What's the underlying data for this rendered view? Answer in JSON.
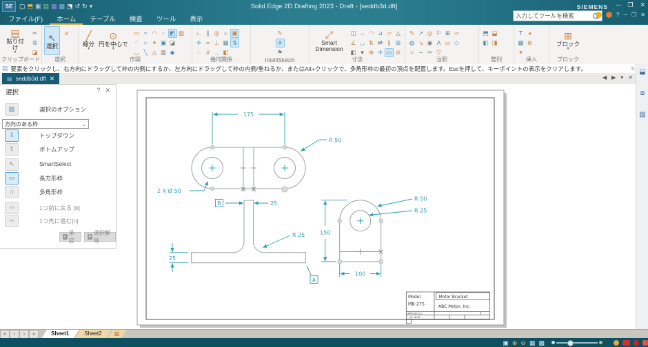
{
  "colors": {
    "titlebar": "#1e6b7e",
    "dimension_accent": "#2f9fb0",
    "ribbon_bg": "#f4f3f1",
    "statusbar": "#0c5061",
    "highlight": "#cfe7f7"
  },
  "window": {
    "app_icon": "SE",
    "title": "Solid Edge 2D Drafting 2023 - Draft - [seddb3d.dft]",
    "brand": "SIEMENS",
    "controls": {
      "minimize": "─",
      "maximize": "❐",
      "close": "✕"
    },
    "doc_controls": {
      "help": "?",
      "minimize": "─",
      "restore": "❐",
      "close": "✕"
    },
    "quick_access": [
      "▢|#e8eef2",
      "⬒|#e8b54d",
      "▣|#b9cdea",
      "▤|#8fc48f",
      "▦|#9b8fd8",
      "▩|#8fb3d8",
      "⬔|#e8eef2",
      "↺|#e8eef2",
      "↻|#e8eef2",
      "▾|#cfe0e8"
    ]
  },
  "search": {
    "placeholder": "入力してツールを検索"
  },
  "menu_tabs": [
    {
      "label": "ファイル(F)"
    },
    {
      "label": "ホーム",
      "active": true
    },
    {
      "label": "テーブル"
    },
    {
      "label": "検査"
    },
    {
      "label": "ツール"
    },
    {
      "label": "表示"
    }
  ],
  "ribbon": {
    "groups": [
      {
        "label": "クリップボード",
        "bigs": [
          {
            "label": "貼り付け",
            "glyph": "▤|#c77f3d",
            "arrow": true
          }
        ],
        "grid": [
          [
            "✂|#777"
          ],
          [
            "⧉|#4b8ca8"
          ],
          [
            "◪|#c77f3d"
          ]
        ]
      },
      {
        "label": "選択",
        "bigs": [
          {
            "label": "選択",
            "glyph": "↖|#4a6f8a",
            "active": true
          }
        ],
        "grid": [
          [
            "⧈|#c77f3d"
          ]
        ]
      },
      {
        "label": "作図",
        "bigs": [
          {
            "label": "線分",
            "glyph": "╱|#c77f3d",
            "arrow": true
          },
          {
            "label": "円を中心で",
            "glyph": "⊙|#c77f3d",
            "arrow": true
          }
        ],
        "grid": [
          [
            "▭|#c77f3d",
            "≈|#4b8ca8",
            "◠|#c77f3d",
            "▫|#4b8ca8",
            "◩|#4b8ca8|1",
            "▨|#c77f3d"
          ],
          [
            "◜|#c77f3d",
            "○|#4b8ca8",
            "✦|#c77f3d",
            "▣|#4b8ca8",
            "◪|#777"
          ],
          [
            "◡|#c77f3d",
            "╲|#4b8ca8",
            "△|#c77f3d",
            "▥|#777",
            "◆|#4b8ca8"
          ]
        ]
      },
      {
        "label": "幾何関係",
        "bigs": [],
        "grid": [
          [
            "∟|#c77f3d",
            "∥|#4b8ca8",
            "◎|#c77f3d",
            "⌂|#777",
            "▣|#c77f3d|1"
          ],
          [
            "✛|#4b8ca8",
            "=|#777",
            "⊥|#c77f3d",
            "▦|#4b8ca8",
            "⇅|#4b8ca8|1"
          ],
          [
            "◌|#4b8ca8",
            "#|#c77f3d",
            "‥|#777",
            "◧|#c77f3d"
          ]
        ]
      },
      {
        "label": "IntelliSketch",
        "bigs": [],
        "grid": [
          [
            "✎|#c77f3d"
          ],
          [
            "✛|#4b8ca8|1"
          ],
          [
            "⚑|#777"
          ]
        ]
      },
      {
        "label": "寸法",
        "bigs": [
          {
            "label": "Smart Dimension",
            "glyph": "⤢|#c77f3d"
          }
        ],
        "grid": [
          [
            "◫|#c77f3d",
            "↔|#4b8ca8",
            "◠|#c77f3d",
            "⊿|#4b8ca8",
            "▱|#c77f3d",
            "△|#777"
          ],
          [
            "∠|#c77f3d",
            "◡|#4b8ca8",
            "⇅|#c77f3d",
            "⇄|#777",
            "∥|#c77f3d",
            "⊞|#4b8ca8"
          ],
          [
            "◧|#777",
            "▾|#555",
            "⊕|#c77f3d",
            "✛|#4b8ca8",
            "▭|#4b8ca8|1",
            "⊘|#c77f3d"
          ]
        ]
      },
      {
        "label": "注釈",
        "bigs": [],
        "grid": [
          [
            "✎|#c77f3d",
            "↗|#4b8ca8",
            "◎|#c77f3d",
            "⚐|#777",
            "⊞|#4b8ca8",
            "⇨|#c77f3d"
          ],
          [
            "◍|#4b8ca8",
            "↘|#c77f3d",
            "◉|#777",
            "A|#4b8ca8",
            "▭|#c77f3d",
            "◇|#4b8ca8"
          ],
          [
            "≈|#c77f3d",
            "∽|#4b8ca8",
            "✑|#777",
            "▽|#c77f3d"
          ]
        ]
      },
      {
        "label": "整列",
        "bigs": [],
        "grid": [
          [
            "⬒|#4b8ca8",
            "⬓|#c77f3d"
          ],
          [
            "◧|#4b8ca8",
            "◨|#c77f3d"
          ]
        ]
      },
      {
        "label": "挿入",
        "bigs": [],
        "grid": [
          [
            "T|#2b6fb0",
            "◕|#c77f3d"
          ],
          [
            "▦|#4b8ca8",
            "⊕|#c77f3d"
          ],
          [
            "✦|#c77f3d"
          ]
        ]
      },
      {
        "label": "ブロック",
        "bigs": [
          {
            "label": "ブロック",
            "glyph": "⊞|#c77f3d",
            "arrow": true
          }
        ],
        "grid": []
      }
    ]
  },
  "prompt": {
    "text": "要素をクリックし、右方向にドラッグして枠の内側にするか、左方向にドラッグして枠の内側/重ねるか、またはAlt+クリックで、多角形枠の最初の頂点を配置します。Escを押して、キーポイントの表示をクリアします。"
  },
  "doc_tab": {
    "label": "seddb3d.dft",
    "close": "✕",
    "nav": [
      "◀|#555",
      "▶|#555",
      "▾|#555",
      "✕|#555"
    ]
  },
  "panel": {
    "title": "選択",
    "help_icon": "?",
    "close_icon": "✕",
    "options": {
      "glyph": "▧",
      "label": "選択のオプション"
    },
    "dropdown": {
      "value": "方向のある枠",
      "chevron": "⌄"
    },
    "items": [
      {
        "glyph": "⇩",
        "label": "トップダウン",
        "active": true
      },
      {
        "glyph": "⇧",
        "label": "ボトムアップ"
      },
      {
        "glyph": "↖",
        "label": "SmartSelect"
      },
      {
        "glyph": "▭",
        "label": "長方形枠",
        "active": true
      },
      {
        "glyph": "⌂",
        "label": "多角形枠"
      },
      {
        "glyph": "⇦",
        "label": "1つ前に戻る [b]"
      },
      {
        "glyph": "⇨",
        "label": "1つ先に進む[n]"
      }
    ],
    "accept": {
      "glyph": "✓",
      "label": "承認"
    },
    "deselect": {
      "glyph": "✕",
      "label": "選択解除"
    }
  },
  "right_strip": {
    "icons": [
      "⬓|#3a6ea8",
      "⧈|#3a6ea8",
      "▧|#3a6ea8"
    ]
  },
  "drawing": {
    "top_view": {
      "dim_width": "175",
      "dim_radius": "R 50",
      "dim_holes": "2 X Ø 50"
    },
    "front_view": {
      "dim_stem": "25",
      "dim_fillet": "R 25",
      "dim_base": "25",
      "datum_a": "A",
      "datum_b": "B"
    },
    "side_view": {
      "dim_radius": "R 50",
      "dim_hole": "R 25",
      "dim_height": "150",
      "dim_width": "100"
    },
    "title_block": {
      "model_label": "Model",
      "model_no": "MB-275",
      "part_name": "Motor Bracket",
      "company": "ABC Motor, Inc.",
      "approved": "APPD BY: JCC",
      "date": "12-16-02"
    }
  },
  "sheet_bar": {
    "nav": [
      "«|#444",
      "‹|#444",
      "›|#444",
      "»|#444"
    ],
    "tabs": [
      {
        "label": "Sheet1",
        "active": true
      },
      {
        "label": "Sheet2"
      }
    ],
    "extra_tab_icon": [
      "▨|#c06030"
    ]
  },
  "status_bar": {
    "view_icons": [
      "▣|#cfe0e6",
      "⊕|#d8c27a",
      "⊖|#d8c27a",
      "▦|#cfe0e6",
      "▩|#cfe0e6"
    ]
  }
}
